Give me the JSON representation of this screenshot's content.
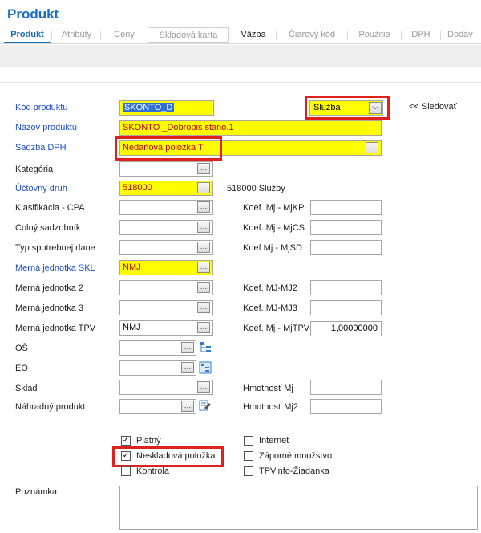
{
  "window": {
    "title": "Produkt"
  },
  "tabs": [
    {
      "label": "Produkt"
    },
    {
      "label": "Atribúty"
    },
    {
      "label": "Ceny"
    },
    {
      "label": "Skladová karta"
    },
    {
      "label": "Väzba"
    },
    {
      "label": "Čiarový kód"
    },
    {
      "label": "Použitie"
    },
    {
      "label": "DPH"
    },
    {
      "label": "Dodáv"
    }
  ],
  "form": {
    "kod_produktu": {
      "label": "Kód produktu",
      "value": "SKONTO_D"
    },
    "typ": {
      "value": "Služba"
    },
    "sledovat": {
      "label": "<< Sledovať"
    },
    "nazov_produktu": {
      "label": "Názov produktu",
      "value": "SKONTO _Dobropis stano.1"
    },
    "sadzba_dph": {
      "label": "Sadzba DPH",
      "value": "Nedaňová položka T"
    },
    "kategoria": {
      "label": "Kategória",
      "value": ""
    },
    "uctovny_druh": {
      "label": "Účtovný druh",
      "value": "518000",
      "desc": "518000 Služby"
    },
    "klasifikacia": {
      "label": "Klasifikácia - CPA",
      "value": ""
    },
    "colny": {
      "label": "Colný sadzobník",
      "value": ""
    },
    "typ_spotrebnej": {
      "label": "Typ spotrebnej dane",
      "value": ""
    },
    "mj_skl": {
      "label": "Merná jednotka SKL",
      "value": "NMJ"
    },
    "mj2": {
      "label": "Merná jednotka 2",
      "value": ""
    },
    "mj3": {
      "label": "Merná jednotka 3",
      "value": ""
    },
    "mj_tpv": {
      "label": "Merná jednotka TPV",
      "value": "NMJ"
    },
    "os": {
      "label": "OŠ",
      "value": ""
    },
    "eo": {
      "label": "EO",
      "value": ""
    },
    "sklad": {
      "label": "Sklad",
      "value": ""
    },
    "nahradny": {
      "label": "Náhradný produkt",
      "value": ""
    },
    "koef_kp": {
      "label": "Koef. Mj - MjKP",
      "value": ""
    },
    "koef_cs": {
      "label": "Koef. Mj - MjCS",
      "value": ""
    },
    "koef_sd": {
      "label": "Koef Mj - MjSD",
      "value": ""
    },
    "koef_mj2": {
      "label": "Koef. MJ-MJ2",
      "value": ""
    },
    "koef_mj3": {
      "label": "Koef. MJ-MJ3",
      "value": ""
    },
    "koef_tpv": {
      "label": "Koef. Mj - MjTPV",
      "value": "1,00000000"
    },
    "hmotnost_mj": {
      "label": "Hmotnosť Mj",
      "value": ""
    },
    "hmotnost_mj2": {
      "label": "Hmotnosť Mj2",
      "value": ""
    },
    "poznamka": {
      "label": "Poznámka",
      "value": ""
    }
  },
  "checkboxes": {
    "platny": {
      "label": "Platný",
      "checked": true
    },
    "neskladova": {
      "label": "Neskladová položka",
      "checked": true
    },
    "kontrola": {
      "label": "Kontrola",
      "checked": false
    },
    "internet": {
      "label": "Internet",
      "checked": false
    },
    "zaporne": {
      "label": "Záporné množstvo",
      "checked": false
    },
    "tpvinfo": {
      "label": "TPVinfo-Žiadanka",
      "checked": false
    }
  },
  "colors": {
    "accent": "#1b6fc2",
    "highlight_field": "#ffff00",
    "highlight_text": "#c00000",
    "annotation": "#e0201f"
  }
}
